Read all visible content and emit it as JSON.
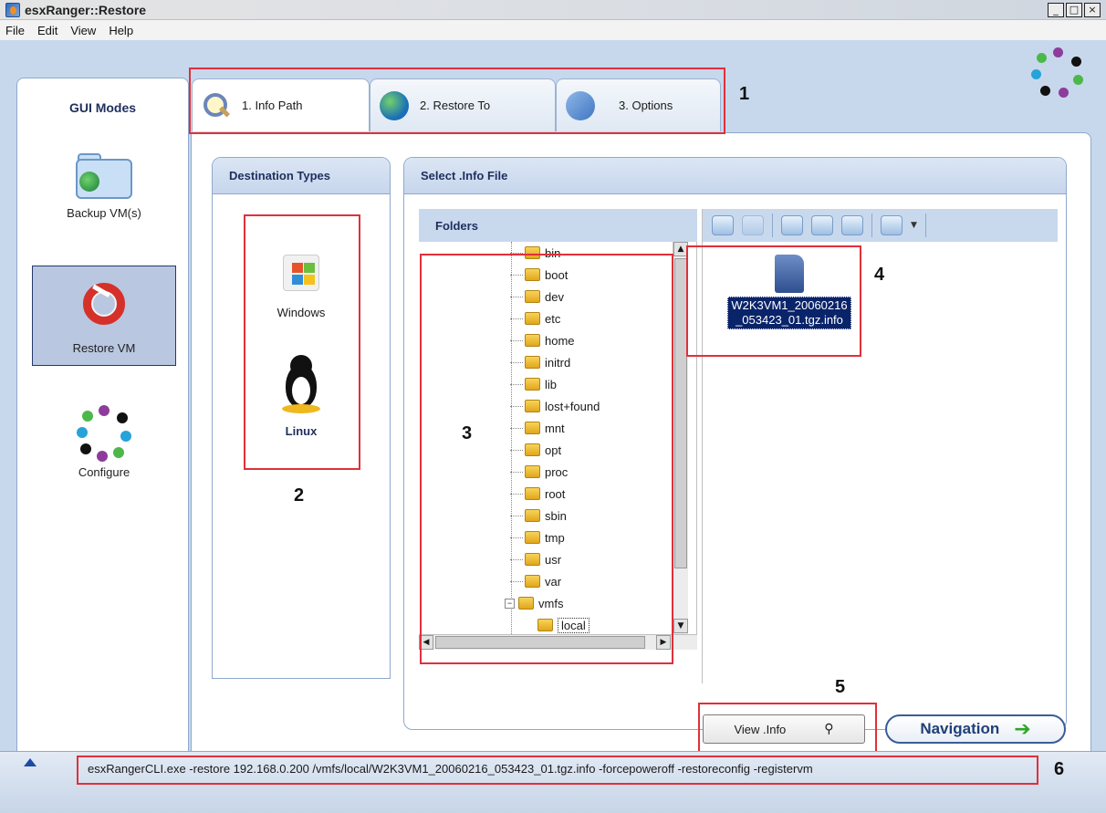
{
  "window": {
    "title": "esxRanger::Restore",
    "buttons": [
      "_",
      "□",
      "×"
    ]
  },
  "menu": [
    "File",
    "Edit",
    "View",
    "Help"
  ],
  "leftnav": {
    "heading": "GUI Modes",
    "items": [
      {
        "label": "Backup VM(s)",
        "icon": "backup-folder-icon"
      },
      {
        "label": "Restore VM",
        "icon": "lifebuoy-icon",
        "selected": true
      },
      {
        "label": "Configure",
        "icon": "dots-icon"
      }
    ]
  },
  "tabs": [
    {
      "label": "1. Info Path",
      "icon": "magnifier-icon",
      "active": true
    },
    {
      "label": "2. Restore To",
      "icon": "globe-icon",
      "active": false
    },
    {
      "label": "3. Options",
      "icon": "options-icon",
      "active": false
    }
  ],
  "destination": {
    "heading": "Destination Types",
    "items": [
      {
        "label": "Windows",
        "icon": "windows-icon"
      },
      {
        "label": "Linux",
        "icon": "linux-tux-icon"
      }
    ]
  },
  "info_file": {
    "heading": "Select .Info File",
    "folders_heading": "Folders",
    "folders": [
      "bin",
      "boot",
      "dev",
      "etc",
      "home",
      "initrd",
      "lib",
      "lost+found",
      "mnt",
      "opt",
      "proc",
      "root",
      "sbin",
      "tmp",
      "usr",
      "var",
      "vmfs",
      "local"
    ],
    "selected_folder": "local",
    "toolbar": [
      "back-icon",
      "forward-icon",
      "add-folder-icon",
      "add-icon",
      "delete-icon",
      "view-icon"
    ],
    "file": {
      "line1": "W2K3VM1_20060216",
      "line2": "_053423_01.tgz.info"
    }
  },
  "buttons": {
    "view_info": "View .Info",
    "navigation": "Navigation"
  },
  "status": {
    "command": "esxRangerCLI.exe -restore 192.168.0.200 /vmfs/local/W2K3VM1_20060216_053423_01.tgz.info -forcepoweroff -restoreconfig -registervm"
  },
  "annotations": [
    "1",
    "2",
    "3",
    "4",
    "5",
    "6"
  ],
  "colors": {
    "annotation_red": "#e0303a",
    "header_navy": "#1f2f5d",
    "selection": "#0a246a"
  }
}
